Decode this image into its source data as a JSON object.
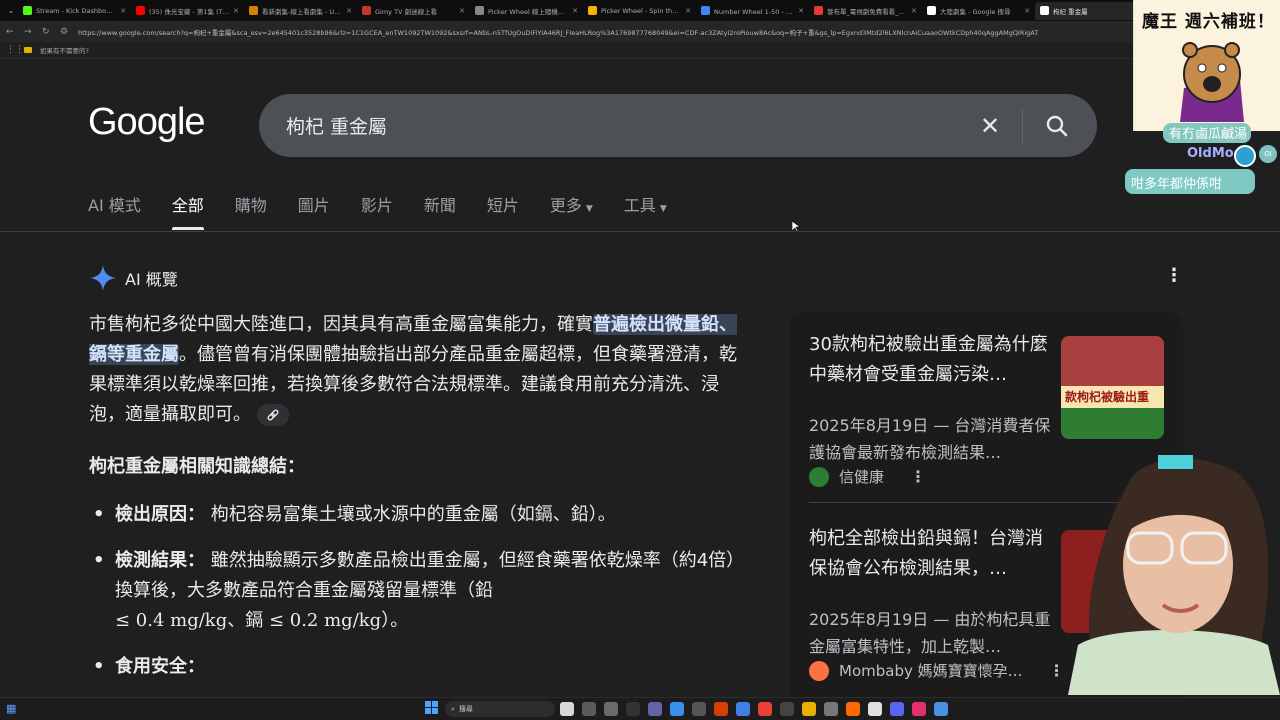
{
  "browser": {
    "tabs": [
      {
        "title": "Stream - Kick Dashboard",
        "color": "#53fc18",
        "active": false
      },
      {
        "title": "(35) 侏光宝藏 - 第1集 (The G",
        "color": "#ff0000",
        "active": false
      },
      {
        "title": "看新劇集-線上看劇集 - UBVID",
        "color": "#d48400",
        "active": false
      },
      {
        "title": "Gimy TV 劇迷線上看",
        "color": "#c0392b",
        "active": false
      },
      {
        "title": "Picker Wheel 線上隨機選擇器",
        "color": "#888888",
        "active": false
      },
      {
        "title": "Picker Wheel - Spin the Whe",
        "color": "#f4b400",
        "active": false
      },
      {
        "title": "Number Wheel 1-50 - 隨機生",
        "color": "#4285f4",
        "active": false
      },
      {
        "title": "發布單_電視劇免費看看_電視",
        "color": "#e53935",
        "active": false
      },
      {
        "title": "大陸劇集 - Google 搜尋",
        "color": "#ffffff",
        "active": false
      },
      {
        "title": "枸杞 重金屬",
        "color": "#ffffff",
        "active": true
      }
    ],
    "url": "https://www.google.com/search?q=枸杞+重金屬&sca_esv=2e645401c3528b96&rlz=1C1GCEA_enTW1092TW1092&sxsrf=ANbL-n5TfUgOuDiFiYIA46RJ_FIeaHLRog%3A1769877768049&ei=CDF-ac3ZAtyI2roPiouw8Ac&oq=枸子+重&gs_lp=Egxnd3Mtd2l6LXNlcnAiCuaaoOWtkCDph40qAggAMgQIRigAT",
    "bookmark": "如果有不需要的?"
  },
  "google": {
    "logo": "Google",
    "query": "枸杞 重金屬",
    "nav": [
      {
        "label": "AI 模式",
        "active": false,
        "caret": false
      },
      {
        "label": "全部",
        "active": true,
        "caret": false
      },
      {
        "label": "購物",
        "active": false,
        "caret": false
      },
      {
        "label": "圖片",
        "active": false,
        "caret": false
      },
      {
        "label": "影片",
        "active": false,
        "caret": false
      },
      {
        "label": "新聞",
        "active": false,
        "caret": false
      },
      {
        "label": "短片",
        "active": false,
        "caret": false
      },
      {
        "label": "更多",
        "active": false,
        "caret": true
      },
      {
        "label": "工具",
        "active": false,
        "caret": true
      }
    ]
  },
  "ai": {
    "heading": "AI 概覽",
    "p1": "市售枸杞多從中國大陸進口，因其具有高重金屬富集能力，確實",
    "highlight": "普遍檢出微量鉛、鎘等重金屬",
    "p2": "。儘管曾有消保團體抽驗指出部分產品重金屬超標，但食藥署澄清，乾果標準須以乾燥率回推，若換算後多數符合法規標準。建議食用前充分清洗、浸泡，適量攝取即可。",
    "summary": "枸杞重金屬相關知識總結：",
    "bullets": [
      {
        "label": "檢出原因：",
        "text": "枸杞容易富集土壤或水源中的重金屬（如鎘、鉛）。"
      },
      {
        "label": "檢測結果：",
        "text": "雖然抽驗顯示多數產品檢出重金屬，但經食藥署依乾燥率（約4倍）換算後，大多數產品符合重金屬殘留量標準（鉛"
      },
      {
        "label": "食用安全：",
        "text": ""
      }
    ],
    "math": "≤ 0.4 mg/kg、鎘 ≤ 0.2 mg/kg）。"
  },
  "cards": [
    {
      "title": "30款枸杞被驗出重金屬為什麼中藥材會受重金屬污染…",
      "desc": "2025年8月19日 — 台灣消費者保護協會最新發布檢測結果…",
      "source": "信健康",
      "icon_color": "#2e7d32",
      "thumb_text": "款枸杞被驗出重"
    },
    {
      "title": "枸杞全部檢出鉛與鎘！台灣消保協會公布檢測結果，…",
      "desc": "2025年8月19日 — 由於枸杞具重金屬富集特性，加上乾製…",
      "source": "Mombaby 媽媽寶寶懷孕…",
      "icon_color": "#ff7043",
      "thumb_text": ""
    }
  ],
  "stream": {
    "title": "魔王 週六補班！",
    "chat_user": "OldMoc",
    "chat_badge": "OI",
    "chat_top": "有冇鹵瓜鹹湯",
    "chat_msg": "咁多年都仲係咁"
  },
  "taskbar": {
    "search": "搜尋"
  }
}
